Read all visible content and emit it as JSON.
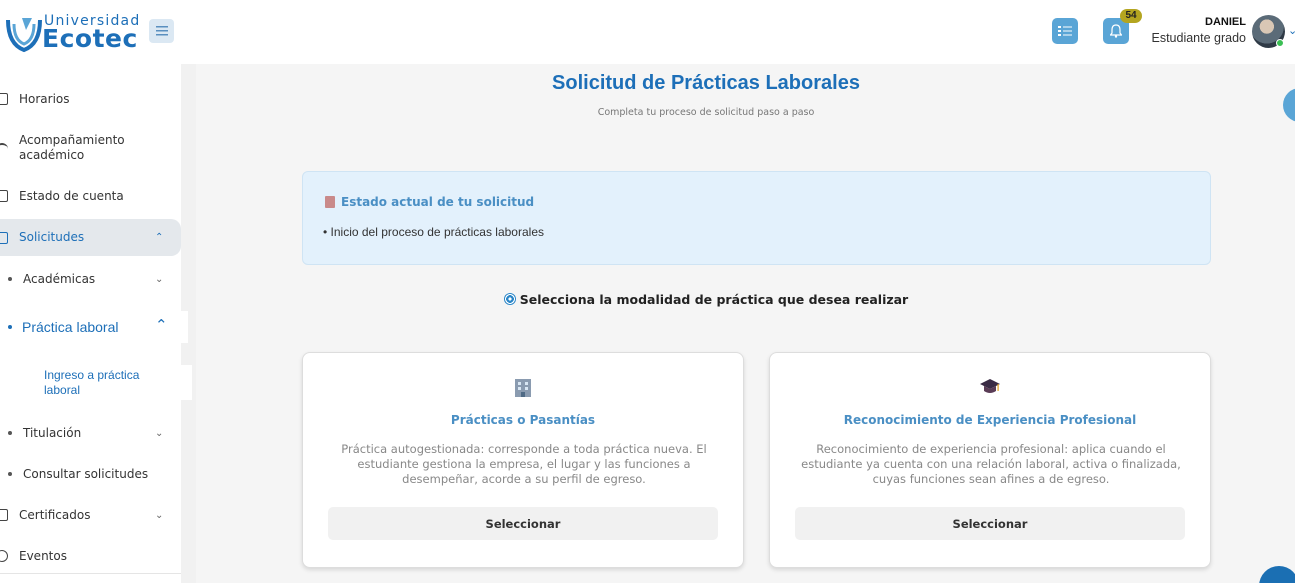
{
  "header": {
    "logo_top": "Universidad",
    "logo_main": "Ecotec",
    "notifications_count": "54",
    "user_name": "DANIEL",
    "user_role": "Estudiante grado"
  },
  "sidebar": {
    "items": [
      {
        "label": "Horarios"
      },
      {
        "label": "Acompañamiento académico"
      },
      {
        "label": "Estado de cuenta"
      },
      {
        "label": "Solicitudes"
      },
      {
        "label": "Académicas"
      },
      {
        "label": "Práctica laboral"
      },
      {
        "label": "Ingreso a práctica laboral"
      },
      {
        "label": "Titulación"
      },
      {
        "label": "Consultar solicitudes"
      },
      {
        "label": "Certificados"
      },
      {
        "label": "Eventos"
      }
    ]
  },
  "main": {
    "title": "Solicitud de Prácticas Laborales",
    "subtitle": "Completa tu proceso de solicitud paso a paso",
    "status": {
      "title": "Estado actual de tu solicitud",
      "text": "• Inicio del proceso de prácticas laborales"
    },
    "select_title": "Selecciona la modalidad de práctica que desea realizar",
    "cards": [
      {
        "title": "Prácticas o Pasantías",
        "description": "Práctica autogestionada: corresponde a toda práctica nueva. El estudiante gestiona la empresa, el lugar y las funciones a desempeñar, acorde a su perfil de egreso.",
        "button": "Seleccionar"
      },
      {
        "title": "Reconocimiento de Experiencia Profesional",
        "description": "Reconocimiento de experiencia profesional: aplica cuando el estudiante ya cuenta con una relación laboral, activa o finalizada, cuyas funciones sean afines a de egreso.",
        "button": "Seleccionar"
      }
    ]
  },
  "colors": {
    "brand": "#1d6fb8",
    "accent": "#5aa5d6",
    "status_bg": "#e3f1fc"
  }
}
